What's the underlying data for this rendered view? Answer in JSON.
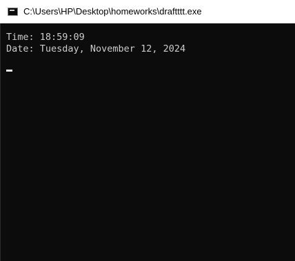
{
  "window": {
    "title": "C:\\Users\\HP\\Desktop\\homeworks\\draftttt.exe",
    "icon": "console-app-icon"
  },
  "console": {
    "lines": [
      "Time: 18:59:09",
      "Date: Tuesday, November 12, 2024"
    ],
    "cursor": "blinking-underscore",
    "colors": {
      "background": "#0c0c0c",
      "text": "#cccccc"
    }
  }
}
